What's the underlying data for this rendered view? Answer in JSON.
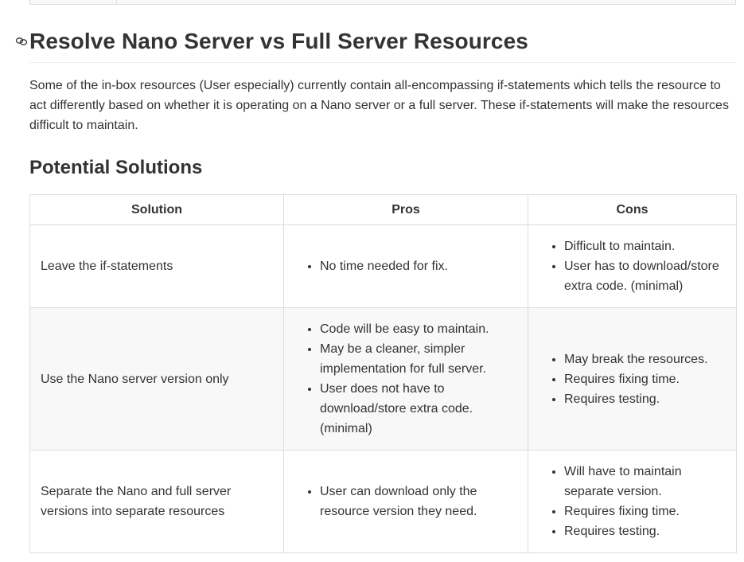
{
  "heading": {
    "anchor_icon": "link-icon",
    "title": "Resolve Nano Server vs Full Server Resources"
  },
  "intro": "Some of the in-box resources (User especially) currently contain all-encompassing if-statements which tells the resource to act differently based on whether it is operating on a Nano server or a full server. These if-statements will make the resources difficult to maintain.",
  "subheading": "Potential Solutions",
  "table": {
    "headers": [
      "Solution",
      "Pros",
      "Cons"
    ],
    "rows": [
      {
        "solution": "Leave the if-statements",
        "pros": [
          "No time needed for fix."
        ],
        "cons": [
          "Difficult to maintain.",
          "User has to download/store extra code. (minimal)"
        ]
      },
      {
        "solution": "Use the Nano server version only",
        "pros": [
          "Code will be easy to maintain.",
          "May be a cleaner, simpler implementation for full server.",
          "User does not have to download/store extra code. (minimal)"
        ],
        "cons": [
          "May break the resources.",
          "Requires fixing time.",
          "Requires testing."
        ]
      },
      {
        "solution": "Separate the Nano and full server versions into separate resources",
        "pros": [
          "User can download only the resource version they need."
        ],
        "cons": [
          "Will have to maintain separate version.",
          "Requires fixing time.",
          "Requires testing."
        ]
      }
    ]
  }
}
